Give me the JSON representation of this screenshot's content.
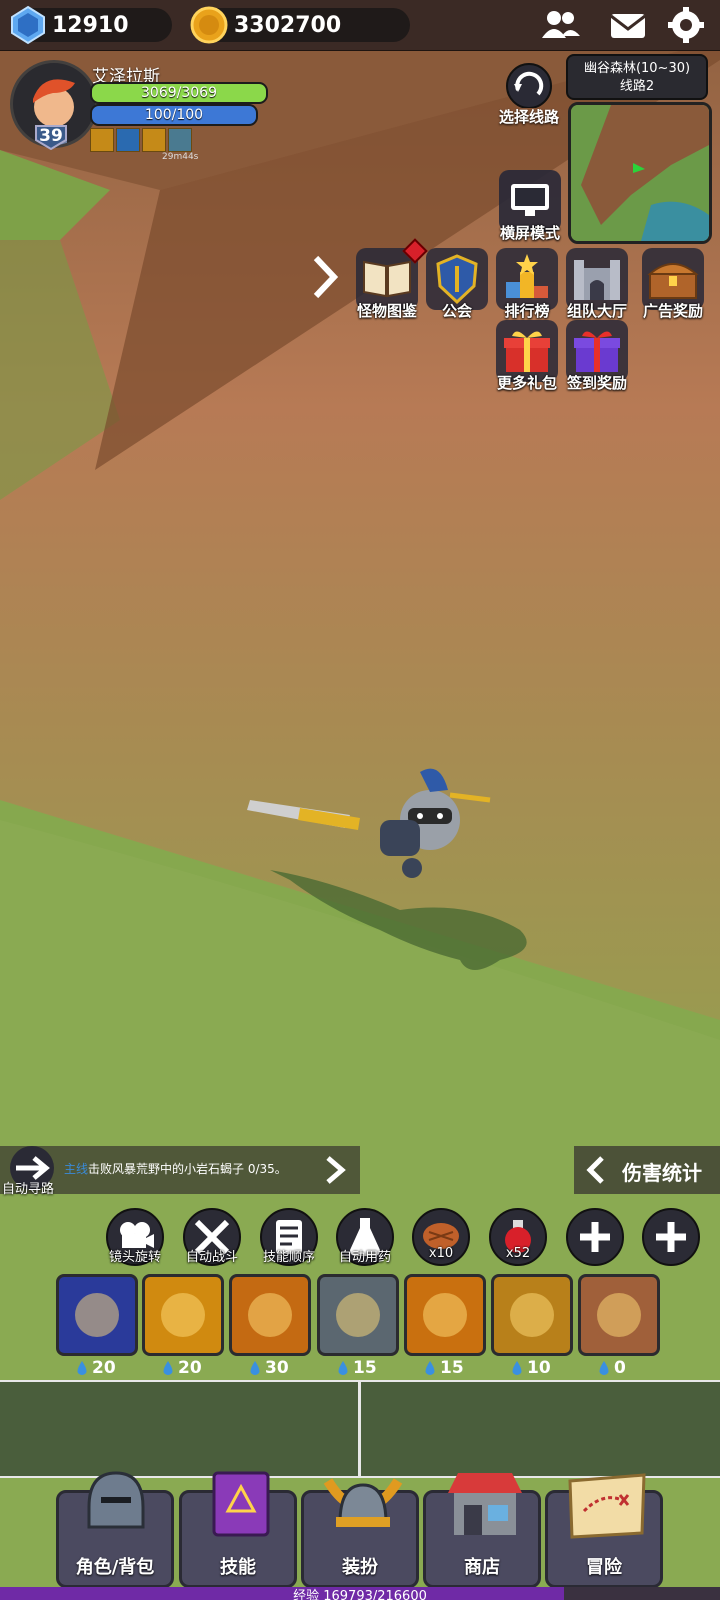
{
  "currency": {
    "gems": "12910",
    "coins": "3302700"
  },
  "top_icons": [
    "friends-icon",
    "mail-icon",
    "settings-icon"
  ],
  "player": {
    "name": "艾泽拉斯",
    "level": "39",
    "hp": "3069/3069",
    "mp": "100/100",
    "hp_fraction": 1.0,
    "mp_fraction": 1.0,
    "buff_timer": "29m44s"
  },
  "route": {
    "label": "选择线路"
  },
  "map": {
    "zone": "幽谷森林(10~30)",
    "line": "线路2"
  },
  "landscape": {
    "label": "横屏模式"
  },
  "menu": [
    {
      "label": "怪物图鉴",
      "icon": "book-icon"
    },
    {
      "label": "公会",
      "icon": "guild-shield-icon"
    },
    {
      "label": "排行榜",
      "icon": "trophy-icon"
    },
    {
      "label": "组队大厅",
      "icon": "castle-icon"
    },
    {
      "label": "广告奖励",
      "icon": "treasure-chest-icon"
    },
    {
      "label": "更多礼包",
      "icon": "gift-icon"
    },
    {
      "label": "签到奖励",
      "icon": "gift-purple-icon"
    }
  ],
  "quest": {
    "auto_path": "自动寻路",
    "prefix": "主线",
    "text": "击败风暴荒野中的小岩石蝎子 0/35。"
  },
  "damage_stats": "伤害统计",
  "quick_actions": [
    {
      "label": "镜头旋转",
      "icon": "camera-icon"
    },
    {
      "label": "自动战斗",
      "icon": "crossed-swords-icon"
    },
    {
      "label": "技能顺序",
      "icon": "scroll-icon"
    },
    {
      "label": "自动用药",
      "icon": "potion-icon"
    },
    {
      "label": "x10",
      "icon": "bread-icon"
    },
    {
      "label": "x52",
      "icon": "red-potion-icon"
    },
    {
      "label": "",
      "icon": "plus-icon"
    },
    {
      "label": "",
      "icon": "plus-icon"
    }
  ],
  "skills": [
    {
      "cost": "20",
      "color": "#2a3a9a"
    },
    {
      "cost": "20",
      "color": "#d08a10"
    },
    {
      "cost": "30",
      "color": "#c46a12"
    },
    {
      "cost": "15",
      "color": "#5b6770"
    },
    {
      "cost": "15",
      "color": "#c9700f"
    },
    {
      "cost": "10",
      "color": "#b8801a"
    },
    {
      "cost": "0",
      "color": "#a0603a"
    }
  ],
  "nav": [
    {
      "label": "角色/背包",
      "icon": "helmet-icon"
    },
    {
      "label": "技能",
      "icon": "spellbook-icon"
    },
    {
      "label": "装扮",
      "icon": "viking-helmet-icon"
    },
    {
      "label": "商店",
      "icon": "shop-icon"
    },
    {
      "label": "冒险",
      "icon": "treasure-map-icon"
    }
  ],
  "xp": {
    "text": "经验 169793/216600",
    "fraction": 0.7839
  }
}
